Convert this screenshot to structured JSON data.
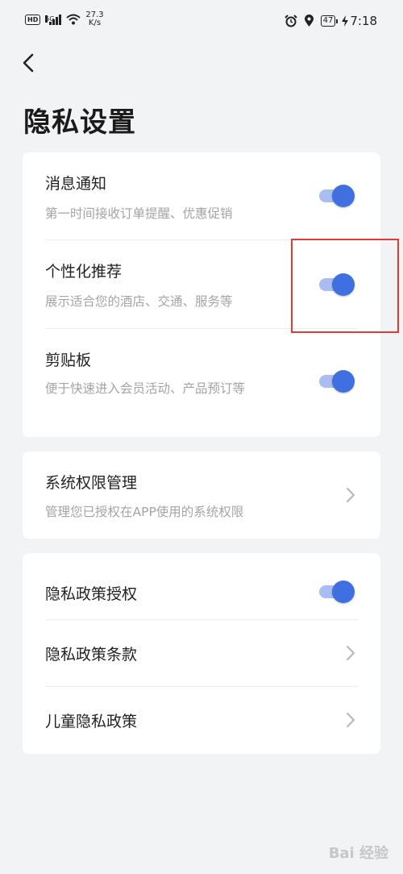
{
  "status_bar": {
    "hd": "HD",
    "signal": "5G",
    "speed_value": "27.3",
    "speed_unit": "K/s",
    "battery": "47",
    "time": "7:18"
  },
  "header": {
    "title": "隐私设置"
  },
  "card1": {
    "items": [
      {
        "title": "消息通知",
        "desc": "第一时间接收订单提醒、优惠促销",
        "on": true
      },
      {
        "title": "个性化推荐",
        "desc": "展示适合您的酒店、交通、服务等",
        "on": true
      },
      {
        "title": "剪贴板",
        "desc": "便于快速进入会员活动、产品预订等",
        "on": true
      }
    ]
  },
  "card2": {
    "title": "系统权限管理",
    "desc": "管理您已授权在APP使用的系统权限"
  },
  "card3": {
    "items": [
      {
        "title": "隐私政策授权",
        "on": true
      },
      {
        "title": "隐私政策条款"
      },
      {
        "title": "儿童隐私政策"
      }
    ]
  },
  "colors": {
    "accent": "#3f6fe0",
    "track": "#a8bdf2",
    "annotation": "#e53935"
  },
  "watermark": "Bai 经验"
}
